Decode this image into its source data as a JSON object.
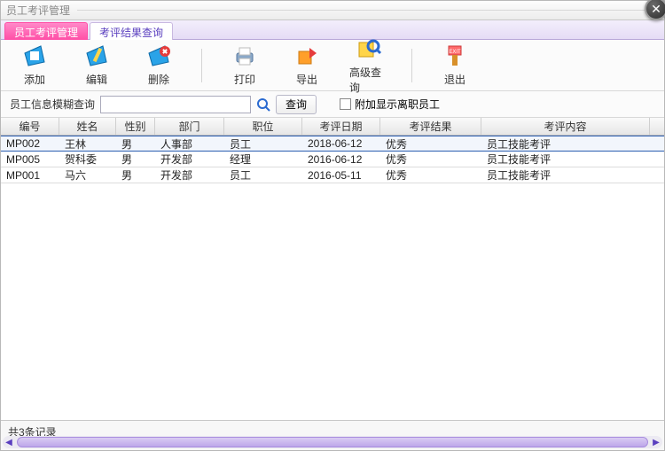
{
  "window": {
    "title": "员工考评管理"
  },
  "tabs": [
    {
      "label": "员工考评管理",
      "active": true
    },
    {
      "label": "考评结果查询",
      "active": false
    }
  ],
  "toolbar": {
    "add": "添加",
    "edit": "编辑",
    "delete": "删除",
    "print": "打印",
    "export": "导出",
    "advanced_query": "高级查询",
    "exit": "退出"
  },
  "search": {
    "label": "员工信息模糊查询",
    "value": "",
    "button": "查询",
    "checkbox_label": "附加显示离职员工",
    "checkbox_checked": false
  },
  "columns": [
    "编号",
    "姓名",
    "性别",
    "部门",
    "职位",
    "考评日期",
    "考评结果",
    "考评内容"
  ],
  "rows": [
    {
      "id": "MP002",
      "name": "王林",
      "gender": "男",
      "dept": "人事部",
      "title": "员工",
      "date": "2018-06-12",
      "result": "优秀",
      "content": "员工技能考评",
      "selected": true
    },
    {
      "id": "MP005",
      "name": "贺科委",
      "gender": "男",
      "dept": "开发部",
      "title": "经理",
      "date": "2016-06-12",
      "result": "优秀",
      "content": "员工技能考评",
      "selected": false
    },
    {
      "id": "MP001",
      "name": "马六",
      "gender": "男",
      "dept": "开发部",
      "title": "员工",
      "date": "2016-05-11",
      "result": "优秀",
      "content": "员工技能考评",
      "selected": false
    }
  ],
  "footer": {
    "count_text": "共3条记录"
  }
}
